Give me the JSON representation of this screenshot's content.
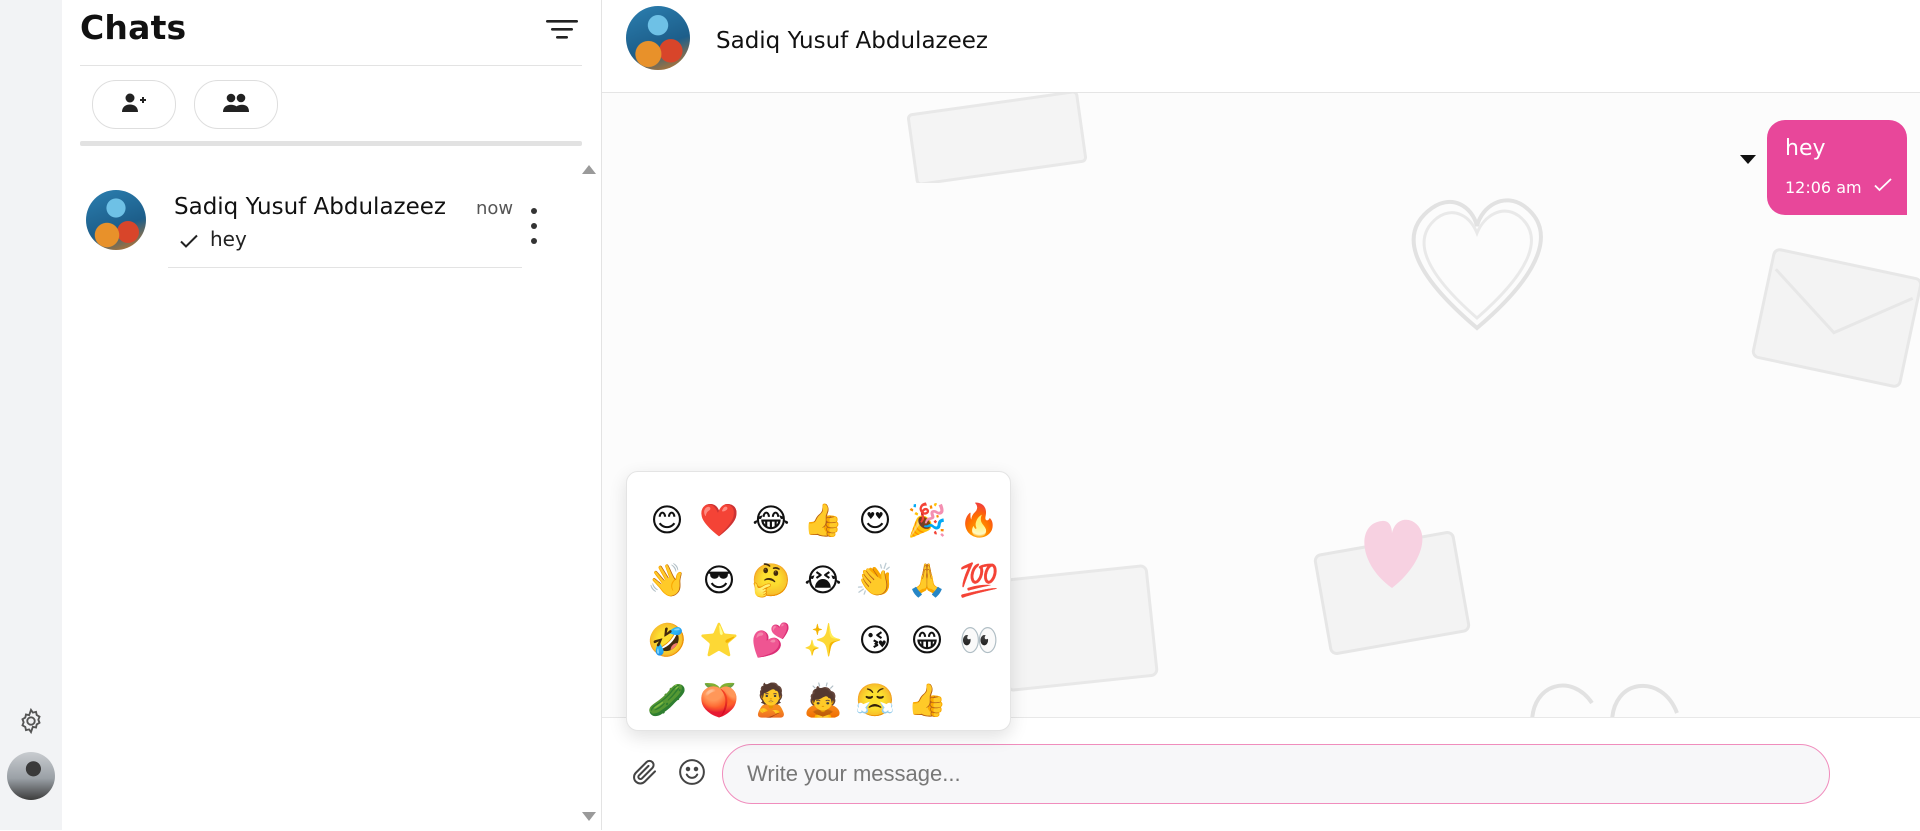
{
  "sidebar": {
    "settings_icon": "gear-icon",
    "user_avatar": "avatar"
  },
  "chat_list": {
    "title": "Chats",
    "filter_icon": "filter-icon",
    "actions": [
      {
        "icon": "add-user-icon"
      },
      {
        "icon": "group-icon"
      }
    ],
    "items": [
      {
        "name": "Sadiq Yusuf Abdulazeez",
        "time": "now",
        "preview": "hey",
        "status_icon": "check-icon"
      }
    ]
  },
  "conversation": {
    "contact_name": "Sadiq Yusuf Abdulazeez",
    "messages": [
      {
        "text": "hey",
        "time": "12:06 am",
        "outgoing": true
      }
    ],
    "bubble_color": "#e8479a"
  },
  "emoji_picker": {
    "emojis": [
      "😊",
      "❤️",
      "😂",
      "👍",
      "😍",
      "🎉",
      "🔥",
      "👋",
      "😎",
      "🤔",
      "😭",
      "👏",
      "🙏",
      "💯",
      "🤣",
      "⭐",
      "💕",
      "✨",
      "😘",
      "😁",
      "👀",
      "🥒",
      "🍑",
      "🙎",
      "🙇",
      "😤",
      "👍"
    ]
  },
  "composer": {
    "placeholder": "Write your message...",
    "accent": "#f08dbd"
  }
}
